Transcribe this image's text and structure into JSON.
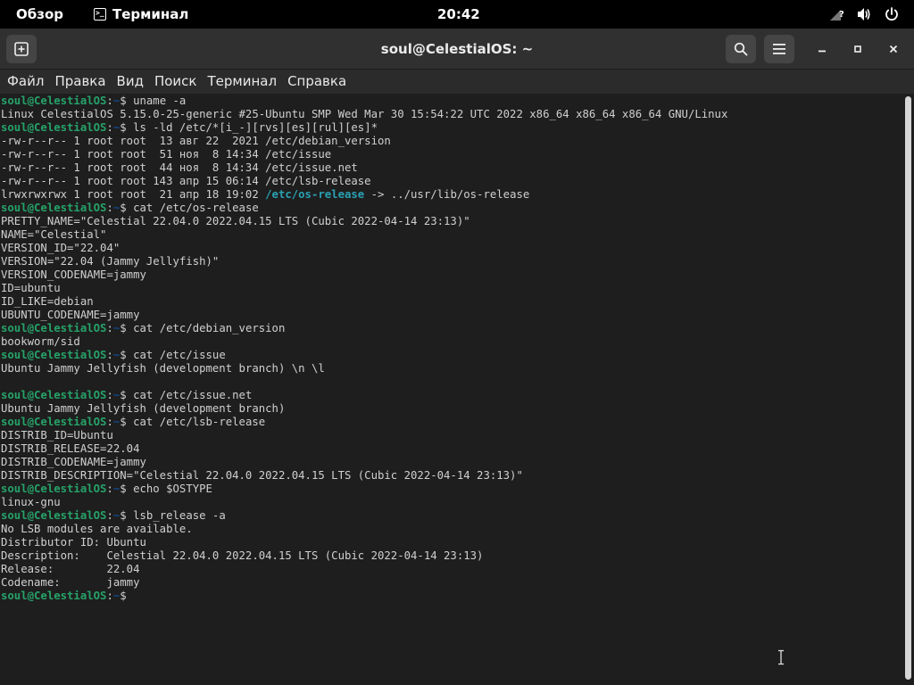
{
  "topbar": {
    "activities": "Обзор",
    "app_menu": "Терминал",
    "clock": "20:42",
    "tray_icons": [
      "network-question-icon",
      "volume-icon",
      "power-icon"
    ]
  },
  "window": {
    "title": "soul@CelestialOS: ~",
    "buttons": [
      "new-tab-icon",
      "search-icon",
      "hamburger-menu-icon",
      "minimize-icon",
      "maximize-icon",
      "close-icon"
    ]
  },
  "menubar": {
    "items": [
      "Файл",
      "Правка",
      "Вид",
      "Поиск",
      "Терминал",
      "Справка"
    ]
  },
  "prompt": {
    "user_host": "soul@CelestialOS",
    "sep": ":",
    "path": "~",
    "dollar": "$"
  },
  "colors": {
    "prompt_user": "#26a269",
    "prompt_path": "#12488b",
    "symlink": "#2aa1b3",
    "background": "#1e1e1e",
    "foreground": "#d0d0d0"
  },
  "terminal": {
    "lines": [
      {
        "type": "prompt",
        "cmd": "uname -a"
      },
      {
        "type": "out",
        "text": "Linux CelestialOS 5.15.0-25-generic #25-Ubuntu SMP Wed Mar 30 15:54:22 UTC 2022 x86_64 x86_64 x86_64 GNU/Linux"
      },
      {
        "type": "prompt",
        "cmd": "ls -ld /etc/*[i_-][rvs][es][rul][es]*"
      },
      {
        "type": "out",
        "text": "-rw-r--r-- 1 root root  13 авг 22  2021 /etc/debian_version"
      },
      {
        "type": "out",
        "text": "-rw-r--r-- 1 root root  51 ноя  8 14:34 /etc/issue"
      },
      {
        "type": "out",
        "text": "-rw-r--r-- 1 root root  44 ноя  8 14:34 /etc/issue.net"
      },
      {
        "type": "out",
        "text": "-rw-r--r-- 1 root root 143 апр 15 06:14 /etc/lsb-release"
      },
      {
        "type": "link",
        "pre": "lrwxrwxrwx 1 root root  21 апр 18 19:02 ",
        "link": "/etc/os-release",
        "post": " -> ../usr/lib/os-release"
      },
      {
        "type": "prompt",
        "cmd": "cat /etc/os-release"
      },
      {
        "type": "out",
        "text": "PRETTY_NAME=\"Celestial 22.04.0 2022.04.15 LTS (Cubic 2022-04-14 23:13)\""
      },
      {
        "type": "out",
        "text": "NAME=\"Celestial\""
      },
      {
        "type": "out",
        "text": "VERSION_ID=\"22.04\""
      },
      {
        "type": "out",
        "text": "VERSION=\"22.04 (Jammy Jellyfish)\""
      },
      {
        "type": "out",
        "text": "VERSION_CODENAME=jammy"
      },
      {
        "type": "out",
        "text": "ID=ubuntu"
      },
      {
        "type": "out",
        "text": "ID_LIKE=debian"
      },
      {
        "type": "out",
        "text": "UBUNTU_CODENAME=jammy"
      },
      {
        "type": "prompt",
        "cmd": "cat /etc/debian_version"
      },
      {
        "type": "out",
        "text": "bookworm/sid"
      },
      {
        "type": "prompt",
        "cmd": "cat /etc/issue"
      },
      {
        "type": "out",
        "text": "Ubuntu Jammy Jellyfish (development branch) \\n \\l"
      },
      {
        "type": "out",
        "text": ""
      },
      {
        "type": "prompt",
        "cmd": "cat /etc/issue.net"
      },
      {
        "type": "out",
        "text": "Ubuntu Jammy Jellyfish (development branch)"
      },
      {
        "type": "prompt",
        "cmd": "cat /etc/lsb-release"
      },
      {
        "type": "out",
        "text": "DISTRIB_ID=Ubuntu"
      },
      {
        "type": "out",
        "text": "DISTRIB_RELEASE=22.04"
      },
      {
        "type": "out",
        "text": "DISTRIB_CODENAME=jammy"
      },
      {
        "type": "out",
        "text": "DISTRIB_DESCRIPTION=\"Celestial 22.04.0 2022.04.15 LTS (Cubic 2022-04-14 23:13)\""
      },
      {
        "type": "prompt",
        "cmd": "echo $OSTYPE"
      },
      {
        "type": "out",
        "text": "linux-gnu"
      },
      {
        "type": "prompt",
        "cmd": "lsb_release -a"
      },
      {
        "type": "out",
        "text": "No LSB modules are available."
      },
      {
        "type": "out",
        "text": "Distributor ID:\tUbuntu"
      },
      {
        "type": "out",
        "text": "Description:\tCelestial 22.04.0 2022.04.15 LTS (Cubic 2022-04-14 23:13)"
      },
      {
        "type": "out",
        "text": "Release:\t22.04"
      },
      {
        "type": "out",
        "text": "Codename:\tjammy"
      },
      {
        "type": "prompt",
        "cmd": ""
      }
    ]
  }
}
